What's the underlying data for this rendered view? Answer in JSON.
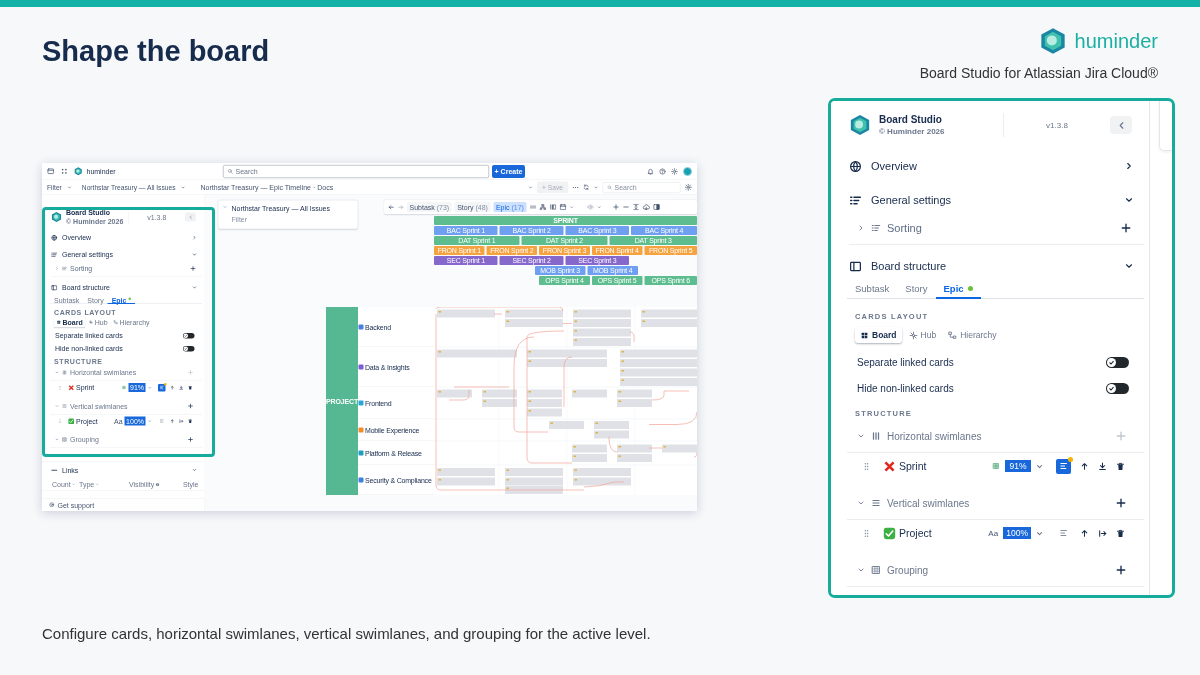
{
  "title": "Shape the board",
  "brand": {
    "name": "huminder",
    "tagline": "Board Studio for Atlassian Jira Cloud®"
  },
  "app_screenshot": {
    "topbar": {
      "product": "huminder",
      "search_placeholder": "Search",
      "create_label": "+ Create"
    },
    "filterbar": {
      "filter": "Filter",
      "source": "Northstar Treasury — All Issues",
      "page_title": "Northstar Treasury — Epic Timeline · Docs",
      "save_label": "+ Save",
      "save_disabled": true,
      "search_placeholder": "Search"
    },
    "panel": {
      "name": "Board Studio",
      "copyright": "© Huminder 2026",
      "version": "v1.3.8",
      "overview": {
        "label": "Overview",
        "expanded": false
      },
      "general_settings": {
        "label": "General settings",
        "expanded": true,
        "sorting": {
          "label": "Sorting",
          "expanded": false
        }
      },
      "board_structure": {
        "label": "Board structure",
        "expanded": true,
        "tabs": [
          {
            "label": "Subtask",
            "selected": false,
            "has_config": false
          },
          {
            "label": "Story",
            "selected": false,
            "has_config": false
          },
          {
            "label": "Epic",
            "selected": true,
            "has_config": true
          }
        ],
        "cards_layout": {
          "heading": "CARDS LAYOUT",
          "options": [
            {
              "label": "Board",
              "kind": "board",
              "selected": true
            },
            {
              "label": "Hub",
              "kind": "hub",
              "selected": false
            },
            {
              "label": "Hierarchy",
              "kind": "hierarchy",
              "selected": false
            }
          ]
        },
        "toggles": [
          {
            "label": "Separate linked cards",
            "on": false
          },
          {
            "label": "Hide non-linked cards",
            "on": false
          }
        ],
        "structure": {
          "heading": "STRUCTURE",
          "groups": [
            {
              "label": "Horizontal swimlanes",
              "kind": "horizontal",
              "can_add": false,
              "rows": [
                {
                  "label": "Sprint",
                  "valid": false,
                  "format": {
                    "kind": "icon"
                  },
                  "percent": "91%",
                  "layout_active": true,
                  "move": {
                    "kind": "bottom"
                  }
                }
              ]
            },
            {
              "label": "Vertical swimlanes",
              "kind": "vertical",
              "can_add": true,
              "rows": [
                {
                  "label": "Project",
                  "valid": true,
                  "format": {
                    "kind": "text",
                    "label": "Aa"
                  },
                  "percent": "100%",
                  "layout_active": false,
                  "move": {
                    "kind": "right"
                  }
                }
              ]
            },
            {
              "label": "Grouping",
              "kind": "grouping",
              "can_add": true
            }
          ]
        }
      },
      "links": {
        "label": "Links",
        "expanded": true,
        "columns": [
          "Count",
          "Type",
          "Visibility",
          "Style"
        ]
      }
    },
    "support_link": "Get support",
    "filter_card": {
      "title": "Northstar Treasury — All Issues",
      "subtitle": "Filter"
    },
    "toolbar": {
      "tabs": [
        {
          "label": "Subtask",
          "count": "(73)",
          "selected": false
        },
        {
          "label": "Story",
          "count": "(48)",
          "selected": false
        },
        {
          "label": "Epic",
          "count": "(17)",
          "selected": true
        }
      ]
    },
    "timeline": {
      "header": "SPRINT",
      "rows": [
        {
          "color": "#6e9ff0",
          "bars": [
            "BAC Sprint 1",
            "BAC Sprint 2",
            "BAC Sprint 3",
            "BAC Sprint 4"
          ]
        },
        {
          "color": "#5dbd8e",
          "bars": [
            "DAT Sprint 1",
            "DAT Sprint 2",
            "DAT Sprint 3"
          ]
        },
        {
          "color": "#f6a23e",
          "bars": [
            "FRON Sprint 1",
            "FRON Sprint 2",
            "FRON Sprint 3",
            "FRON Sprint 4",
            "FRON Sprint 5"
          ]
        },
        {
          "color": "#8667cc",
          "bars": [
            "SEC Sprint 1",
            "SEC Sprint 2",
            "SEC Sprint 3"
          ]
        },
        {
          "color": "#6e9ff0",
          "bars": [
            "MOB Sprint 3",
            "MOB Sprint 4"
          ]
        },
        {
          "color": "#5dbd8e",
          "bars": [
            "OPS Sprint 4",
            "OPS Sprint 5",
            "OPS Sprint 6"
          ]
        }
      ]
    },
    "vertical_lane": "PROJECT",
    "lanes": [
      {
        "label": "Backend",
        "color": "#4a7fe0"
      },
      {
        "label": "Data & Insights",
        "color": "#7b5dd6"
      },
      {
        "label": "Frontend",
        "color": "#29a8d8"
      },
      {
        "label": "Mobile Experience",
        "color": "#f28c28"
      },
      {
        "label": "Platform & Release",
        "color": "#1f9fc0"
      },
      {
        "label": "Security & Compliance",
        "color": "#3f7fe0"
      }
    ]
  },
  "panel": {
    "name": "Board Studio",
    "copyright": "© Huminder 2026",
    "version": "v1.3.8",
    "overview": {
      "label": "Overview",
      "expanded": false
    },
    "general_settings": {
      "label": "General settings",
      "expanded": true,
      "sorting": {
        "label": "Sorting",
        "expanded": false
      }
    },
    "board_structure": {
      "label": "Board structure",
      "expanded": true,
      "tabs": [
        {
          "label": "Subtask",
          "selected": false,
          "has_config": false
        },
        {
          "label": "Story",
          "selected": false,
          "has_config": false
        },
        {
          "label": "Epic",
          "selected": true,
          "has_config": true
        }
      ],
      "cards_layout": {
        "heading": "CARDS LAYOUT",
        "options": [
          {
            "label": "Board",
            "kind": "board",
            "selected": true
          },
          {
            "label": "Hub",
            "kind": "hub",
            "selected": false
          },
          {
            "label": "Hierarchy",
            "kind": "hierarchy",
            "selected": false
          }
        ]
      },
      "toggles": [
        {
          "label": "Separate linked cards",
          "on": false
        },
        {
          "label": "Hide non-linked cards",
          "on": false
        }
      ],
      "structure": {
        "heading": "STRUCTURE",
        "groups": [
          {
            "label": "Horizontal swimlanes",
            "kind": "horizontal",
            "can_add": false,
            "rows": [
              {
                "label": "Sprint",
                "valid": false,
                "format": {
                  "kind": "icon"
                },
                "percent": "91%",
                "layout_active": true,
                "move": {
                  "kind": "bottom"
                }
              }
            ]
          },
          {
            "label": "Vertical swimlanes",
            "kind": "vertical",
            "can_add": true,
            "rows": [
              {
                "label": "Project",
                "valid": true,
                "format": {
                  "kind": "text",
                  "label": "Aa"
                },
                "percent": "100%",
                "layout_active": false,
                "move": {
                  "kind": "right"
                }
              }
            ]
          },
          {
            "label": "Grouping",
            "kind": "grouping",
            "can_add": true
          }
        ]
      }
    }
  },
  "caption": "Configure cards, horizontal swimlanes, vertical swimlanes, and grouping for the active level."
}
